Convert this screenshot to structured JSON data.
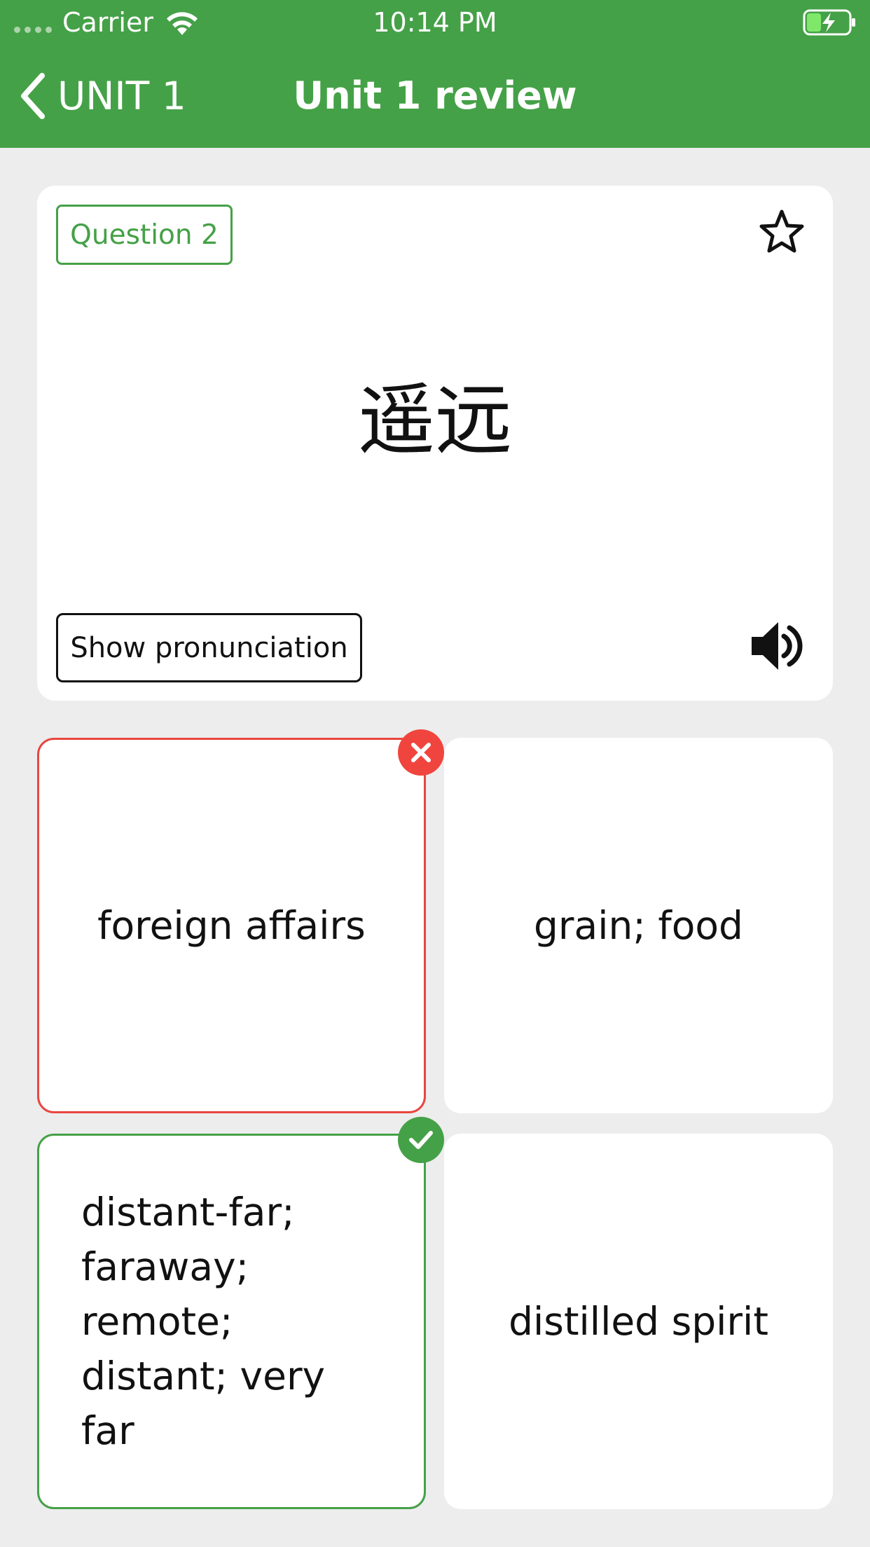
{
  "status_bar": {
    "carrier": "Carrier",
    "time": "10:14 PM"
  },
  "nav": {
    "back_label": "UNIT 1",
    "title": "Unit 1 review"
  },
  "question": {
    "badge": "Question 2",
    "word": "遥远",
    "show_pronunciation_label": "Show pronunciation"
  },
  "options": [
    {
      "text": "foreign affairs",
      "state": "wrong"
    },
    {
      "text": "grain; food",
      "state": "neutral"
    },
    {
      "text": "distant-far; faraway; remote; distant; very far",
      "state": "correct"
    },
    {
      "text": "distilled spirit",
      "state": "neutral"
    }
  ],
  "colors": {
    "header": "#45a147",
    "correct": "#45a147",
    "wrong": "#f0453e",
    "background": "#ededed"
  }
}
